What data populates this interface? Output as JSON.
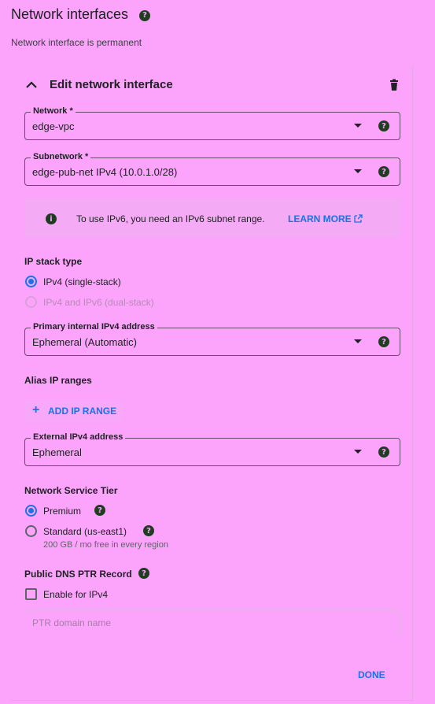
{
  "header": {
    "title": "Network interfaces",
    "subtitle": "Network interface is permanent"
  },
  "card": {
    "title": "Edit network interface",
    "network": {
      "label": "Network *",
      "value": "edge-vpc"
    },
    "subnetwork": {
      "label": "Subnetwork *",
      "value": "edge-pub-net IPv4 (10.0.1.0/28)"
    },
    "info": {
      "text": "To use IPv6, you need an IPv6 subnet range.",
      "link": "LEARN MORE"
    },
    "ip_stack": {
      "title": "IP stack type",
      "options": [
        "IPv4 (single-stack)",
        "IPv4 and IPv6 (dual-stack)"
      ]
    },
    "primary_ip": {
      "label": "Primary internal IPv4 address",
      "value": "Ephemeral (Automatic)"
    },
    "alias": {
      "title": "Alias IP ranges",
      "button": "ADD IP RANGE"
    },
    "external_ip": {
      "label": "External IPv4 address",
      "value": "Ephemeral"
    },
    "tier": {
      "title": "Network Service Tier",
      "premium": "Premium",
      "standard": "Standard (us-east1)",
      "standard_note": "200 GB / mo free in every region"
    },
    "dns": {
      "title": "Public DNS PTR Record",
      "checkbox": "Enable for IPv4",
      "placeholder": "PTR domain name"
    },
    "done": "DONE"
  },
  "colors": {
    "accent": "#1a73e8",
    "background": "#fca4fc",
    "help_icon": "#1f3d1f"
  }
}
